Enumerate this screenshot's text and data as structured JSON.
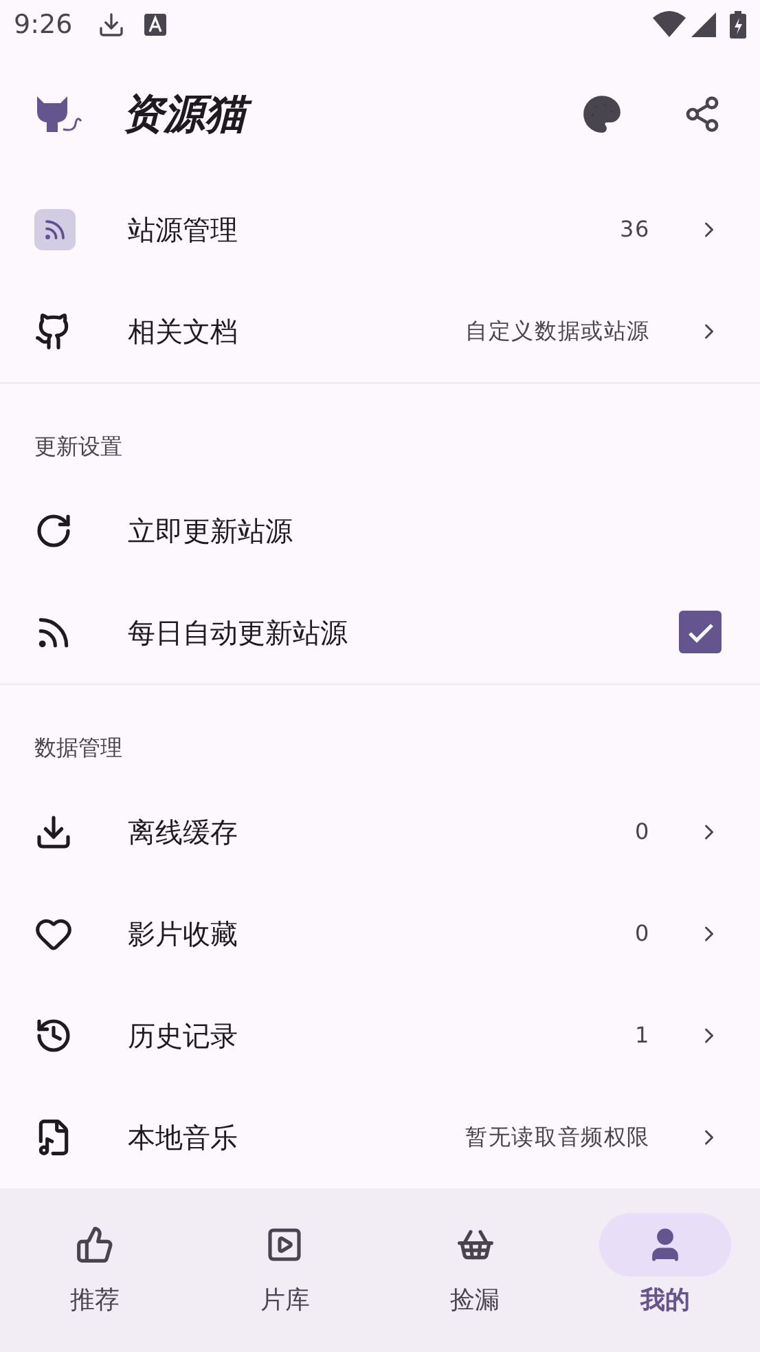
{
  "status_bar": {
    "time": "9:26"
  },
  "app_bar": {
    "title": "资源猫"
  },
  "sections": [
    {
      "items": [
        {
          "kind": "link",
          "label": "站源管理",
          "value": "36"
        },
        {
          "kind": "link",
          "label": "相关文档",
          "value": "自定义数据或站源"
        }
      ]
    },
    {
      "title": "更新设置",
      "items": [
        {
          "kind": "action",
          "label": "立即更新站源"
        },
        {
          "kind": "checkbox",
          "label": "每日自动更新站源",
          "checked": true
        }
      ]
    },
    {
      "title": "数据管理",
      "items": [
        {
          "kind": "link",
          "label": "离线缓存",
          "value": "0"
        },
        {
          "kind": "link",
          "label": "影片收藏",
          "value": "0"
        },
        {
          "kind": "link",
          "label": "历史记录",
          "value": "1"
        },
        {
          "kind": "link",
          "label": "本地音乐",
          "value": "暂无读取音频权限"
        }
      ]
    }
  ],
  "nav": [
    {
      "label": "推荐",
      "selected": false
    },
    {
      "label": "片库",
      "selected": false
    },
    {
      "label": "捡漏",
      "selected": false
    },
    {
      "label": "我的",
      "selected": true
    }
  ]
}
